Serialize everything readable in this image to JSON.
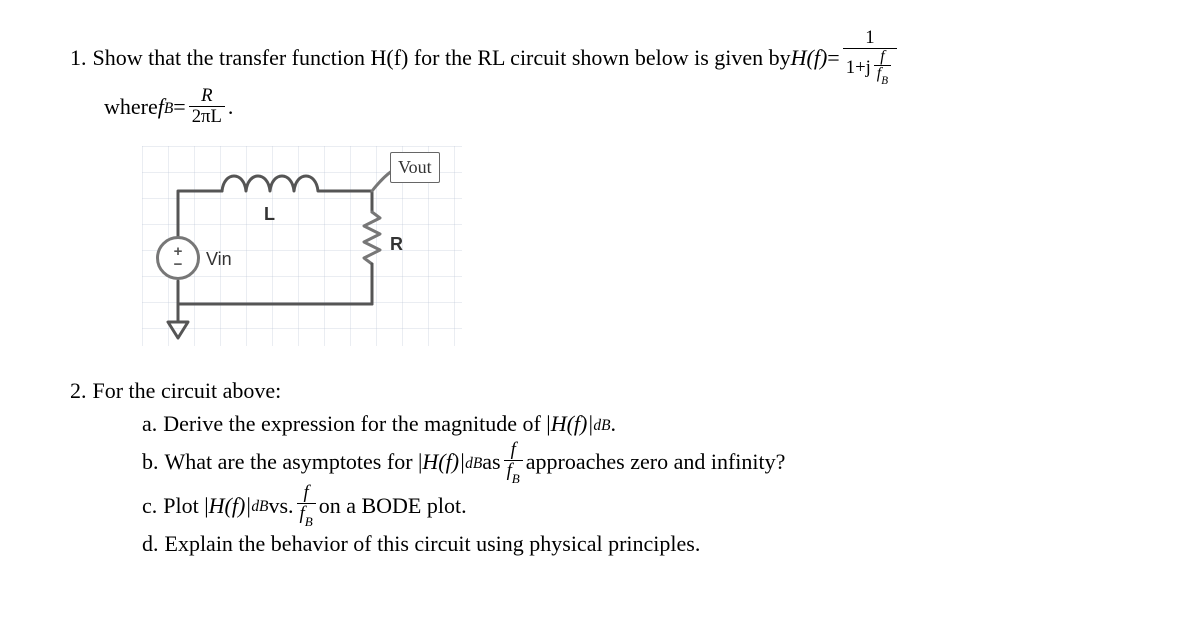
{
  "problem1": {
    "number": "1.",
    "text_a": "Show that the transfer function H(f) for the RL circuit shown below is given by ",
    "Hf": "H(f)",
    "eq": " = ",
    "frac_top": "1",
    "frac_bot_pre": "1+j",
    "frac_bot_inner_top": "f",
    "frac_bot_inner_bot": "f",
    "where": "where ",
    "fB": "f",
    "fB_sub": "B",
    "eq2": " = ",
    "f2_top": "R",
    "f2_bot": "2πL",
    "dot": "."
  },
  "circuit": {
    "vout": "Vout",
    "vin": "Vin",
    "L": "L",
    "R": "R",
    "plus": "+",
    "minus": "−"
  },
  "problem2": {
    "number": "2.",
    "intro": "For the circuit above:",
    "a_letter": "a.",
    "a_text": "Derive the expression for the magnitude of |",
    "a_H": "H(f)|",
    "a_dB": "dB",
    "a_end": ".",
    "b_letter": "b.",
    "b_text": "What are the asymptotes for |",
    "b_H": "H(f)|",
    "b_dB": "dB",
    "b_as": " as ",
    "b_frac_top": "f",
    "b_frac_bot": "f",
    "b_end": " approaches zero and infinity?",
    "c_letter": "c.",
    "c_text": "Plot |",
    "c_H": "H(f)|",
    "c_dB": "dB",
    "c_vs": " vs. ",
    "c_frac_top": "f",
    "c_frac_bot": "f",
    "c_end": " on a BODE plot.",
    "d_letter": "d.",
    "d_text": "Explain the behavior of this circuit using physical principles."
  }
}
